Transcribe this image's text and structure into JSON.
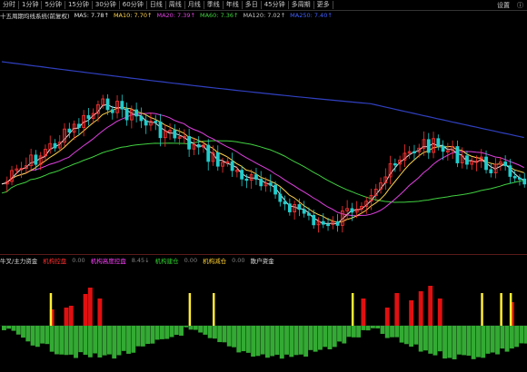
{
  "toolbar": {
    "periods": [
      "分时",
      "1分钟",
      "5分钟",
      "15分钟",
      "30分钟",
      "60分钟",
      "日线",
      "周线",
      "月线",
      "季线",
      "年线",
      "多日",
      "45分钟",
      "多周期",
      "更多"
    ],
    "right_items": [
      "设置",
      "ⓘ"
    ]
  },
  "ma_bar": {
    "title": "十五周期均线系统(前复权)",
    "items": [
      {
        "text": "MA5: 7.78↑",
        "color": "#e8e8e8"
      },
      {
        "text": "MA10: 7.70↑",
        "color": "#ffd34d"
      },
      {
        "text": "MA20: 7.39↑",
        "color": "#e040e0"
      },
      {
        "text": "MA60: 7.36↑",
        "color": "#40d040"
      },
      {
        "text": "MA120: 7.02↑",
        "color": "#c0c0c0"
      },
      {
        "text": "MA250: 7.40↑",
        "color": "#4060ff"
      }
    ]
  },
  "indicator_bar": {
    "title": "牛叉/主力资金",
    "items": [
      {
        "text": "机构控盘",
        "color": "#ff3030"
      },
      {
        "text": "0.00",
        "color": "#808080"
      },
      {
        "text": "机构高度控盘",
        "color": "#ff40ff"
      },
      {
        "text": "8.45↓",
        "color": "#808080"
      },
      {
        "text": "机构建仓",
        "color": "#30d030"
      },
      {
        "text": "0.00",
        "color": "#808080"
      },
      {
        "text": "机构减仓",
        "color": "#ffd030"
      },
      {
        "text": "0.00",
        "color": "#808080"
      },
      {
        "text": "散户资金",
        "color": "#e0e0e0"
      }
    ]
  },
  "colors": {
    "up": "#ff3333",
    "down": "#22cccc",
    "ma5": "#e8e8e8",
    "ma10": "#ffd34d",
    "ma20": "#e040e0",
    "ma60": "#40d040",
    "ma250": "#3040c0",
    "bar_red": "#e01010",
    "bar_yellow": "#ffee33",
    "bar_green": "#33aa33"
  }
}
